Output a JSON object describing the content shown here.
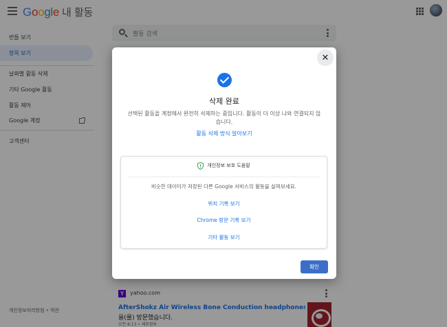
{
  "header": {
    "logo_letters": [
      "G",
      "o",
      "o",
      "g",
      "l",
      "e"
    ],
    "logo_suffix": "내 활동"
  },
  "sidebar": {
    "items": [
      {
        "label": "번들 보기"
      },
      {
        "label": "항목 보기"
      },
      {
        "label": "날짜별 활동 삭제"
      },
      {
        "label": "기타 Google 활동"
      },
      {
        "label": "활동 제어"
      },
      {
        "label": "Google 계정"
      },
      {
        "label": "고객센터"
      }
    ],
    "footer": "개인정보처리방침 • 약관"
  },
  "search": {
    "placeholder": "활동 검색"
  },
  "activity_card": {
    "domain": "yahoo.com",
    "link_text": "AfterShokz Air Wireless Bone Conduction headphones are on sale ...",
    "description": "을(를) 방문했습니다.",
    "meta": "오전 8:13 • 세부정보"
  },
  "dialog": {
    "title": "삭제 완료",
    "body": "선택된 활동을 계정에서 완전히 삭제하는 중입니다. 활동이 더 이상 나와 연결되지 않습니다.",
    "learn_more": "활동 삭제 방식 알아보기",
    "privacy_card": {
      "title": "개인정보 보호 도움말",
      "description": "비슷한 데이터가 저장된 다른 Google 서비스의 활동을 살펴보세요.",
      "links": [
        "위치 기록 보기",
        "Chrome 방문 기록 보기",
        "기타 활동 보기"
      ]
    },
    "confirm_label": "확인"
  },
  "colors": {
    "accent": "#1a73e8",
    "confirm_button": "#3b6fc7",
    "yahoo_brand": "#5f01d1"
  },
  "icons": [
    "menu-icon",
    "apps-icon",
    "search-icon",
    "more-vert-icon",
    "external-link-icon",
    "check-circle-icon",
    "shield-icon",
    "close-icon"
  ]
}
